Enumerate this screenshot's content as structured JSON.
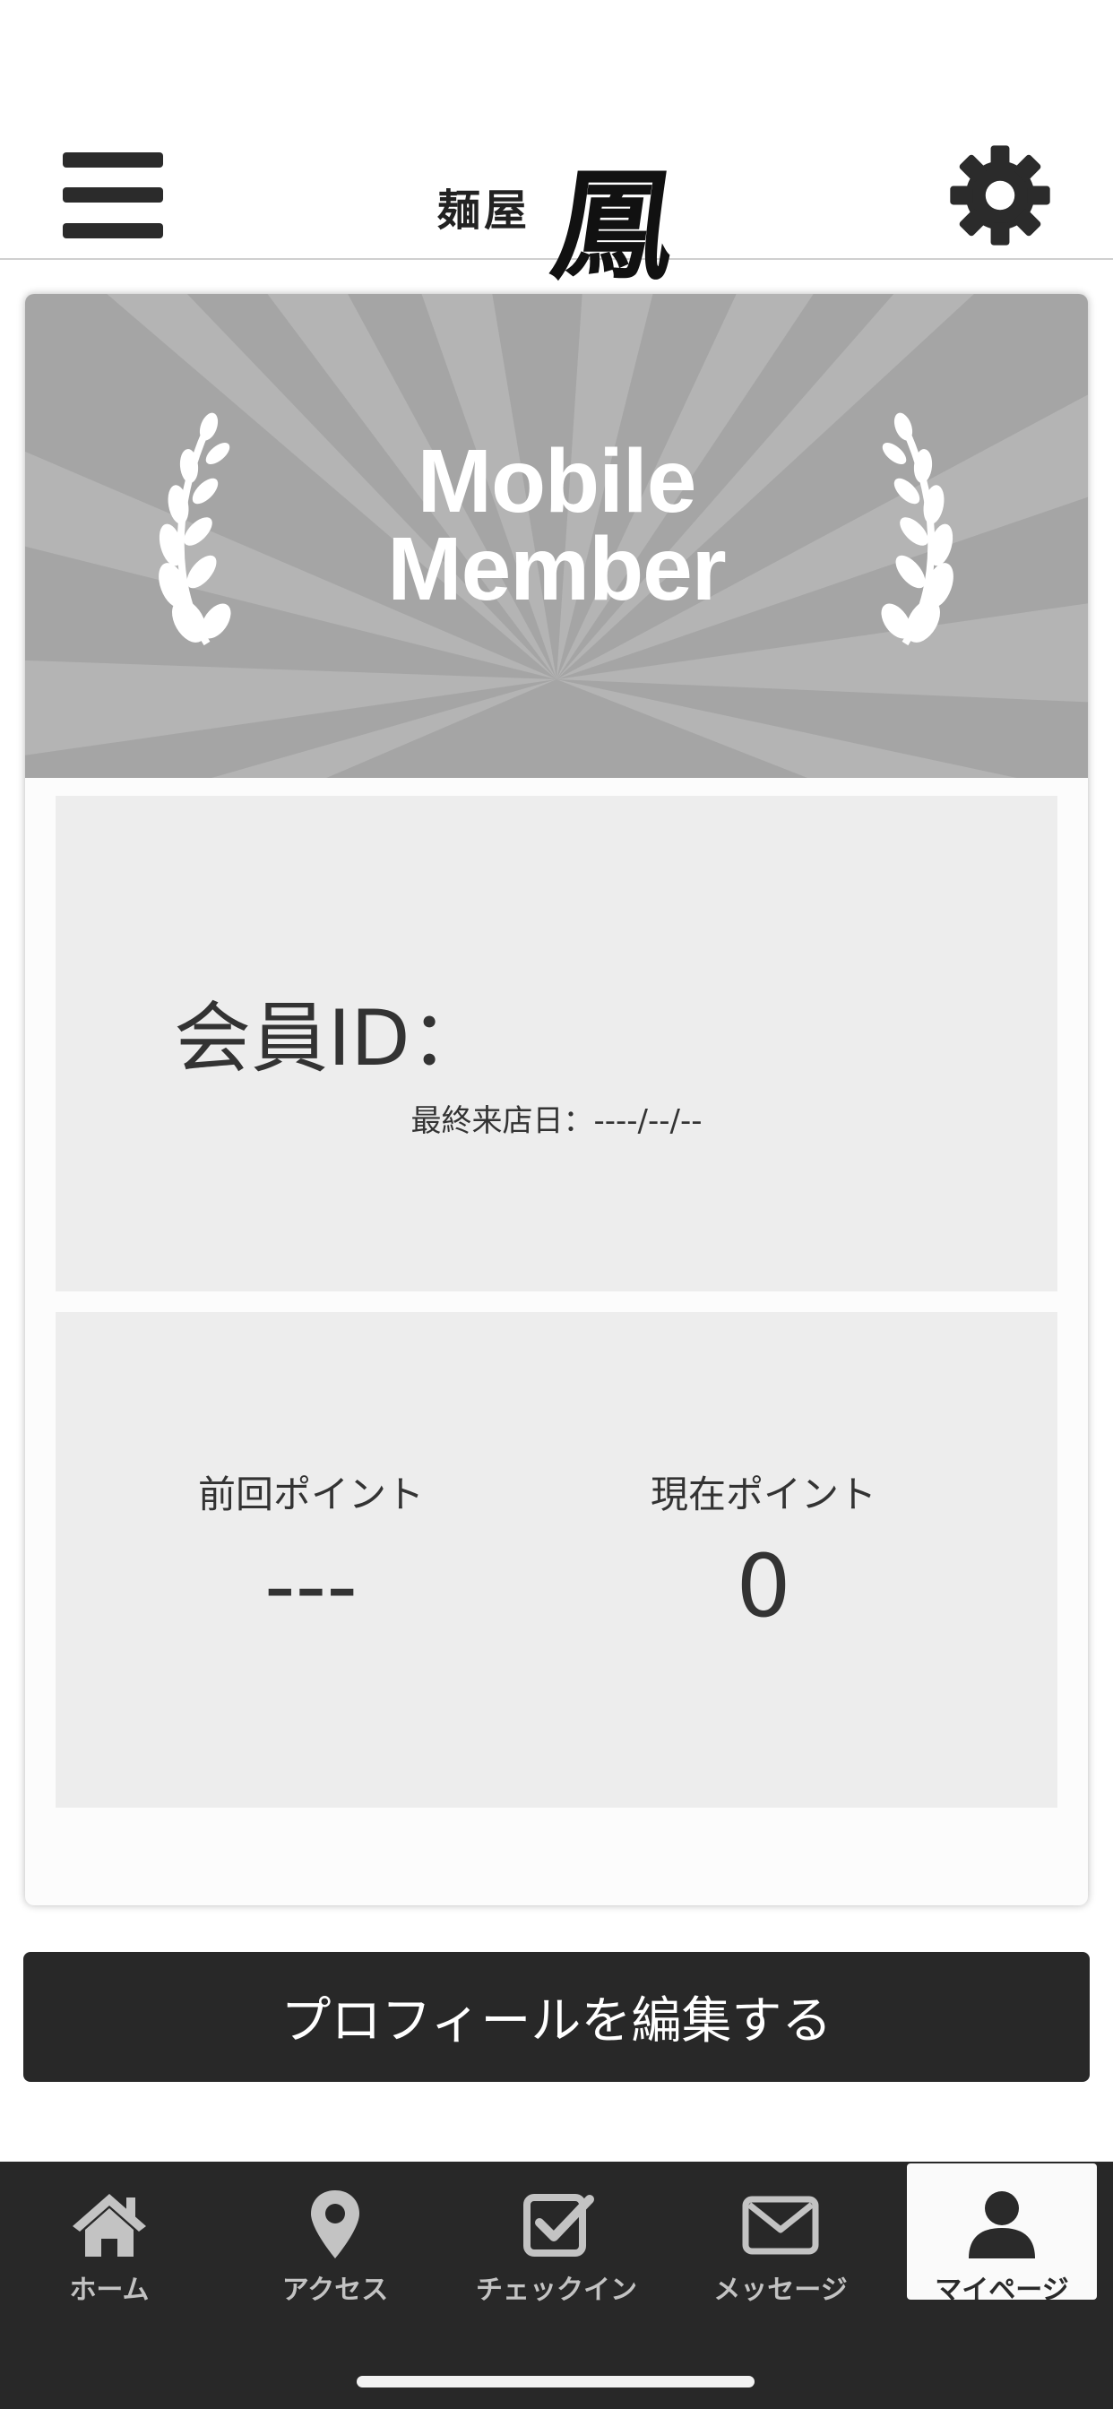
{
  "header": {
    "logo_text_small": "麺屋",
    "logo_text_big": "鳳",
    "menu_icon": "hamburger-menu-icon",
    "settings_icon": "gear-icon"
  },
  "banner": {
    "line1": "Mobile",
    "line2": "Member"
  },
  "member": {
    "id_label": "会員ID：",
    "last_visit_label": "最終来店日：----/--/--"
  },
  "points": {
    "previous_label": "前回ポイント",
    "previous_value": "---",
    "current_label": "現在ポイント",
    "current_value": "0"
  },
  "edit_profile_label": "プロフィールを編集する",
  "tabbar": {
    "items": [
      {
        "label": "ホーム",
        "icon": "home-icon"
      },
      {
        "label": "アクセス",
        "icon": "map-pin-icon"
      },
      {
        "label": "チェックイン",
        "icon": "check-square-icon"
      },
      {
        "label": "メッセージ",
        "icon": "envelope-icon"
      },
      {
        "label": "マイページ",
        "icon": "user-icon"
      }
    ],
    "active_index": 4
  },
  "colors": {
    "dark": "#282828",
    "panel": "#ededed",
    "banner": "#a5a5a5",
    "tab_inactive": "#c3c3c3"
  }
}
